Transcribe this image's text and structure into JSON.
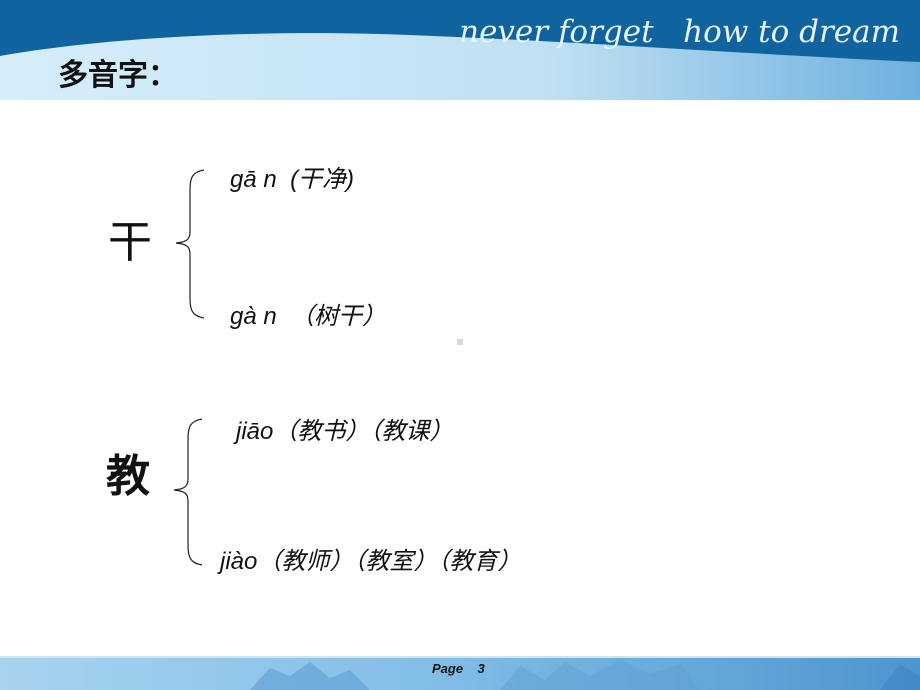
{
  "header": {
    "slogan": "never forget   how to dream",
    "title": "多音字："
  },
  "colors": {
    "header_dark": "#0f64a0",
    "header_light": "#cfe9f7",
    "footer_base": "#7fbce6",
    "text": "#111111"
  },
  "entries": [
    {
      "character": "干",
      "readings": [
        {
          "pinyin": "gā n",
          "examples": "(干净)"
        },
        {
          "pinyin": "gà n",
          "examples": "（树干）"
        }
      ]
    },
    {
      "character": "教",
      "readings": [
        {
          "pinyin": "jiāo",
          "examples": "（教书）（教课）"
        },
        {
          "pinyin": "jiào",
          "examples": "（教师）（教室）（教育）"
        }
      ]
    }
  ],
  "footer": {
    "page_label": "Page",
    "page_number": "3"
  }
}
